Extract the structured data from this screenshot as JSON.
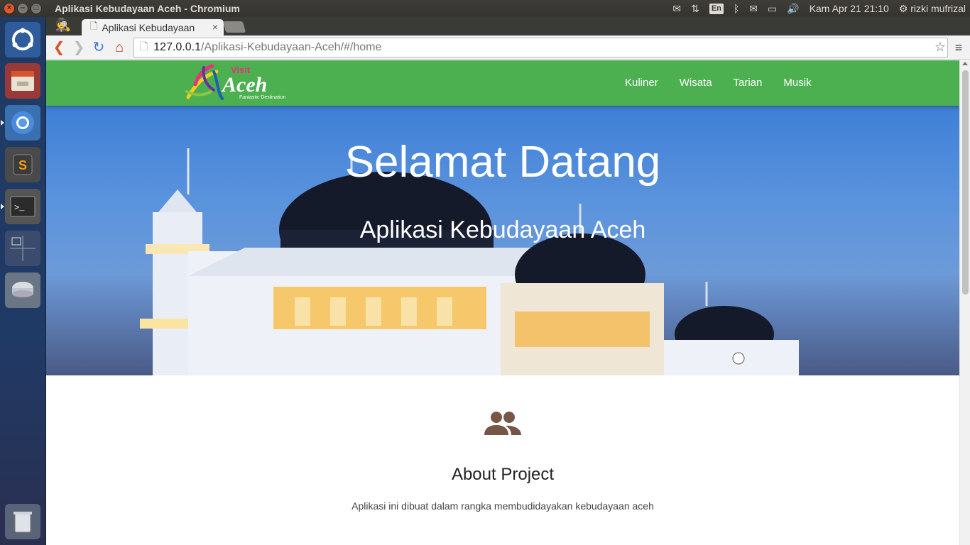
{
  "system": {
    "window_title": "Aplikasi Kebudayaan Aceh - Chromium",
    "lang": "En",
    "clock": "Kam Apr 21 21:10",
    "user": "rizki mufrizal"
  },
  "browser": {
    "tab_title": "Aplikasi Kebudayaan",
    "url_host": "127.0.0.1",
    "url_path": "/Aplikasi-Kebudayaan-Aceh/#/home"
  },
  "site": {
    "logo_top": "Visit",
    "logo_main": "Aceh",
    "logo_tagline": "Fantastic Destination",
    "nav": [
      "Kuliner",
      "Wisata",
      "Tarian",
      "Musik"
    ],
    "brand_color": "#4caf50"
  },
  "hero": {
    "title": "Selamat Datang",
    "subtitle": "Aplikasi Kebudayaan Aceh"
  },
  "about": {
    "icon": "people-icon",
    "title": "About Project",
    "text": "Aplikasi ini dibuat dalam rangka membudidayakan kebudayaan aceh"
  }
}
